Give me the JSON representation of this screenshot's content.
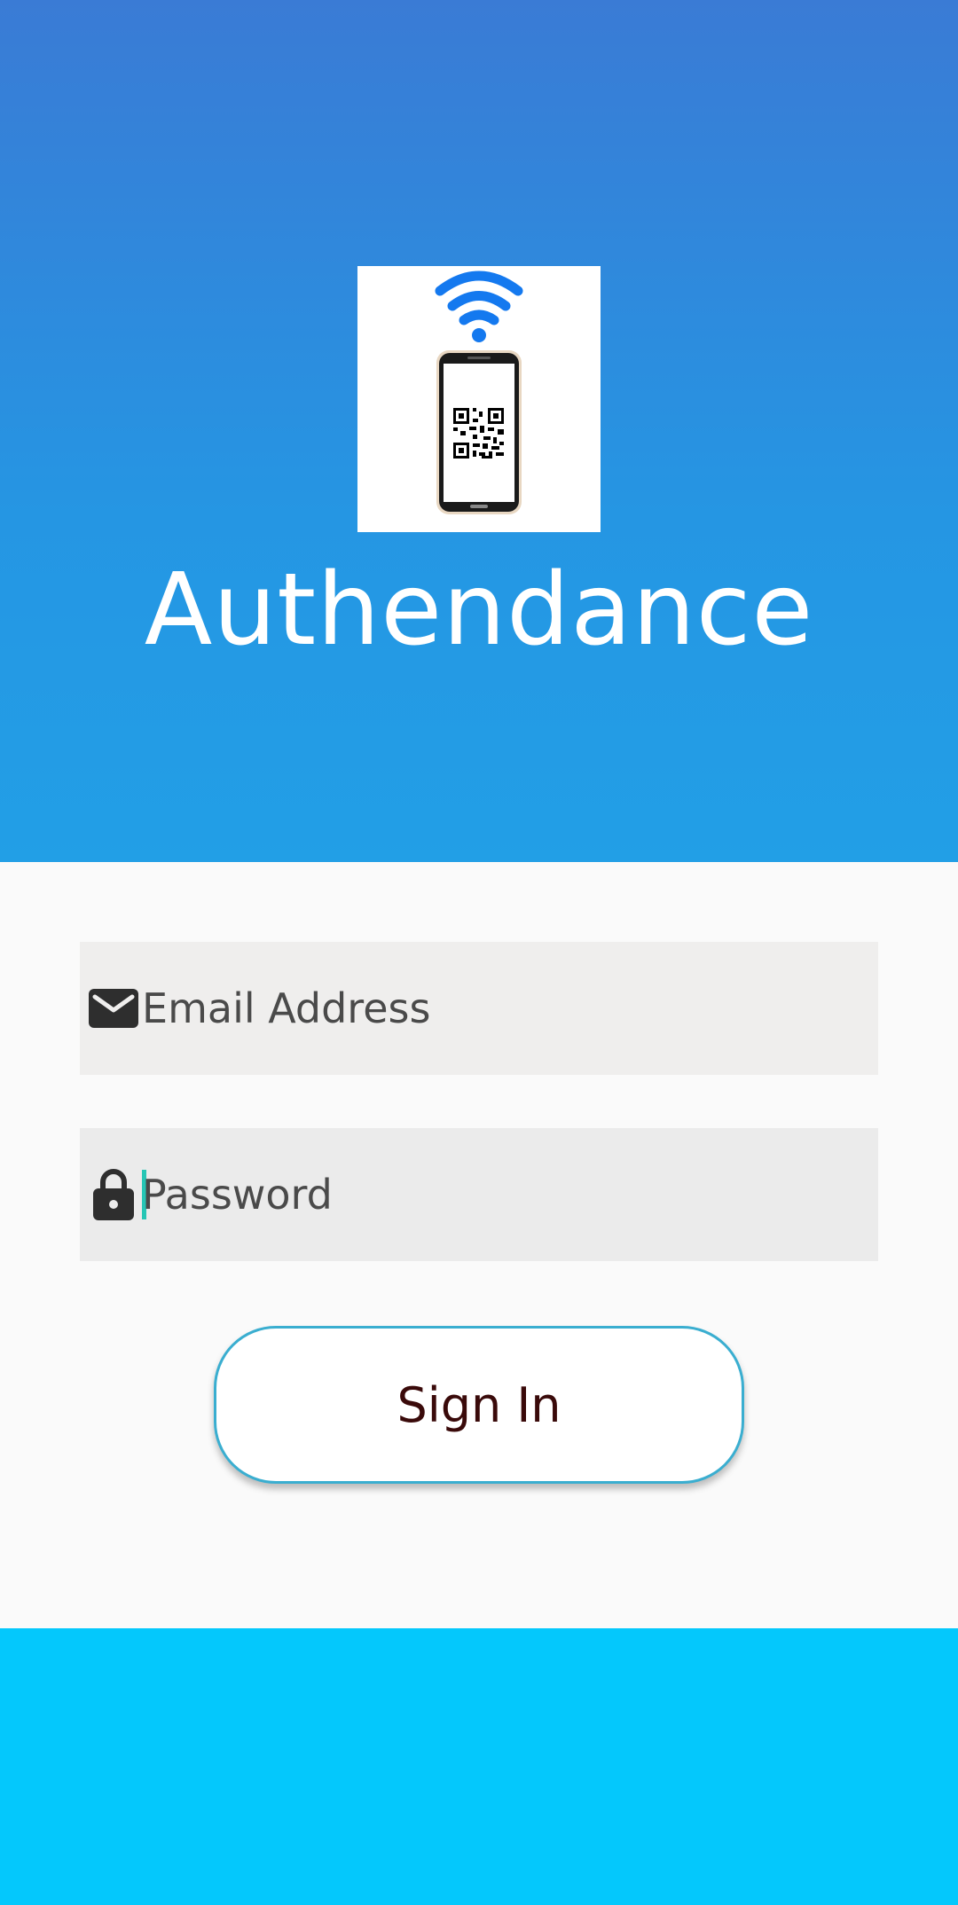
{
  "app": {
    "title": "Authendance"
  },
  "logo": {
    "icon": "phone-qr-wifi-logo",
    "wifi_color": "#1479ef"
  },
  "form": {
    "email": {
      "placeholder": "Email Address",
      "value": "",
      "icon": "envelope-icon"
    },
    "password": {
      "placeholder": "Password",
      "value": "",
      "icon": "lock-icon"
    },
    "signin_label": "Sign In"
  },
  "colors": {
    "header_gradient_top": "#3a7bd5",
    "header_gradient_bottom": "#229fe6",
    "footer": "#04c8fc",
    "button_border": "#3aaed0",
    "caret": "#26c6b5"
  }
}
